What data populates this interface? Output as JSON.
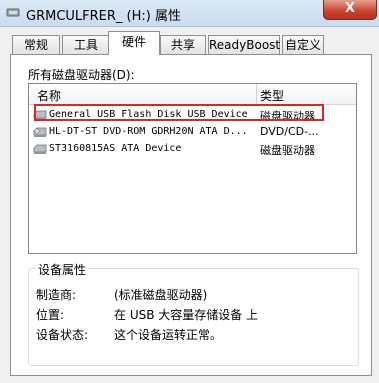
{
  "window": {
    "title": "GRMCULFRER_ (H:) 属性",
    "close_label": "X",
    "close_color": "#c8412c"
  },
  "tabs": [
    {
      "label": "常规",
      "active": false
    },
    {
      "label": "工具",
      "active": false
    },
    {
      "label": "硬件",
      "active": true
    },
    {
      "label": "共享",
      "active": false
    },
    {
      "label": "ReadyBoost",
      "active": false
    },
    {
      "label": "自定义",
      "active": false
    }
  ],
  "hardware": {
    "list_title": "所有磁盘驱动器(D):",
    "columns": {
      "name": "名称",
      "type": "类型"
    },
    "devices": [
      {
        "name": "General USB Flash Disk USB Device",
        "type": "磁盘驱动器",
        "icon": "disk-drive-icon",
        "highlighted": true
      },
      {
        "name": "HL-DT-ST DVD-ROM GDRH20N ATA D...",
        "type": "DVD/CD-...",
        "icon": "dvd-drive-icon",
        "highlighted": false
      },
      {
        "name": "ST3160815AS ATA Device",
        "type": "磁盘驱动器",
        "icon": "disk-drive-icon",
        "highlighted": false
      }
    ]
  },
  "properties": {
    "title": "设备属性",
    "manufacturer_label": "制造商:",
    "manufacturer_value": "(标准磁盘驱动器)",
    "location_label": "位置:",
    "location_value": "在 USB 大容量存储设备 上",
    "status_label": "设备状态:",
    "status_value": "这个设备运转正常。"
  },
  "colors": {
    "highlight_border": "#d02b2b"
  }
}
